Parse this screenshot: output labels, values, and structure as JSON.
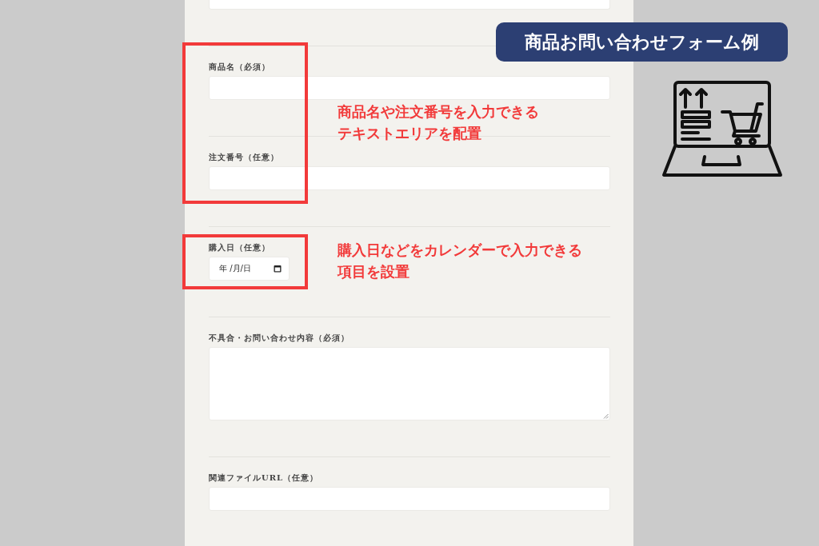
{
  "form": {
    "fields": [
      {
        "kind": "text"
      },
      {
        "kind": "text",
        "label": "商品名（必須）"
      },
      {
        "kind": "text",
        "label": "注文番号（任意）"
      },
      {
        "kind": "date",
        "label": "購入日（任意）",
        "placeholder": "年 /月/日"
      },
      {
        "kind": "textarea",
        "label": "不具合・お問い合わせ内容（必須）"
      },
      {
        "kind": "text",
        "label": "関連ファイルURL（任意）"
      }
    ]
  },
  "badge": {
    "title": "商品お問い合わせフォーム例"
  },
  "annotations": [
    {
      "lines": [
        "商品名や注文番号を入力できる",
        "テキストエリアを配置"
      ]
    },
    {
      "lines": [
        "購入日などをカレンダーで入力できる",
        "項目を設置"
      ]
    }
  ]
}
